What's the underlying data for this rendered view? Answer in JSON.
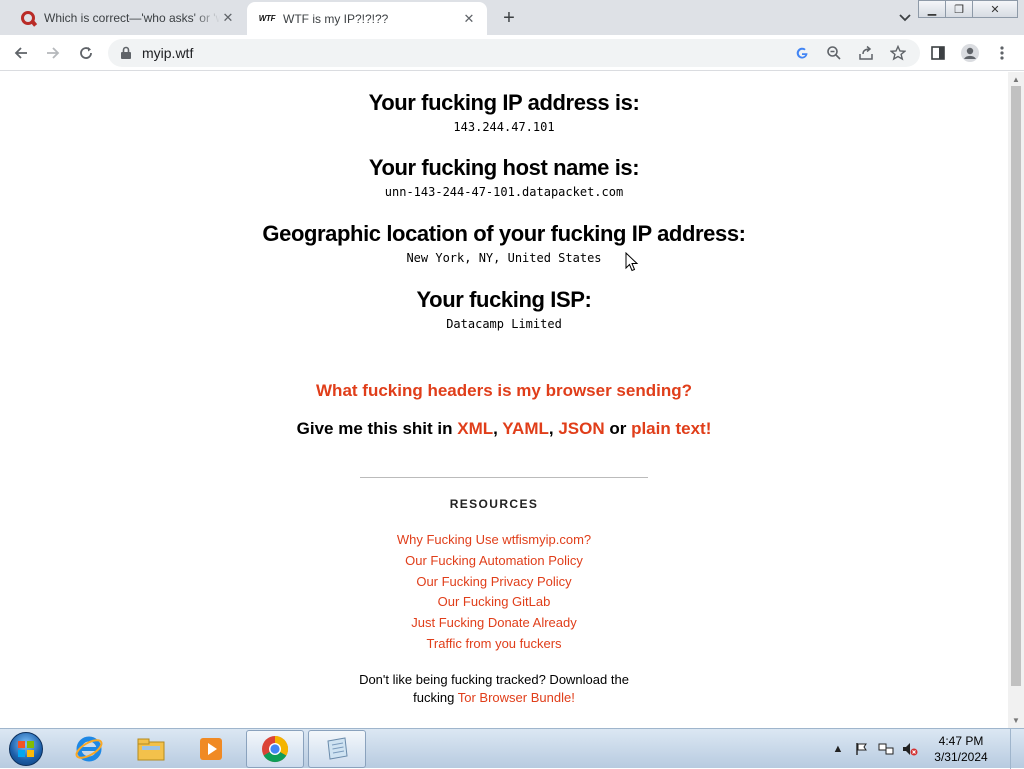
{
  "browser": {
    "tabs": [
      {
        "title": "Which is correct—'who asks' or 'w",
        "icon": "quora-icon"
      },
      {
        "title": "WTF is my IP?!?!??",
        "icon": "wtf-logo",
        "favicon_text": "WTF"
      }
    ],
    "url": "myip.wtf"
  },
  "page": {
    "ip_heading": "Your fucking IP address is:",
    "ip_value": "143.244.47.101",
    "host_heading": "Your fucking host name is:",
    "host_value": "unn-143-244-47-101.datapacket.com",
    "geo_heading": "Geographic location of your fucking IP address:",
    "geo_value": "New York, NY, United States",
    "isp_heading": "Your fucking ISP:",
    "isp_value": "Datacamp Limited",
    "headers_link": "What fucking headers is my browser sending?",
    "give_prefix": "Give me this shit in ",
    "formats": {
      "xml": "XML",
      "yaml": "YAML",
      "json": "JSON",
      "or": " or ",
      "plain": "plain text!",
      "sep": ", "
    },
    "resources_title": "RESOURCES",
    "resources": [
      "Why Fucking Use wtfismyip.com?",
      "Our Fucking Automation Policy",
      "Our Fucking Privacy Policy",
      "Our Fucking GitLab",
      "Just Fucking Donate Already",
      "Traffic from you fuckers"
    ],
    "tracked_line1": "Don't like being fucking tracked? Download the",
    "tracked_line2_prefix": "fucking ",
    "tracked_link": "Tor Browser Bundle!"
  },
  "taskbar": {
    "time": "4:47 PM",
    "date": "3/31/2024"
  },
  "colors": {
    "link": "#e03e1a",
    "tab_bg": "#dee1e6"
  }
}
